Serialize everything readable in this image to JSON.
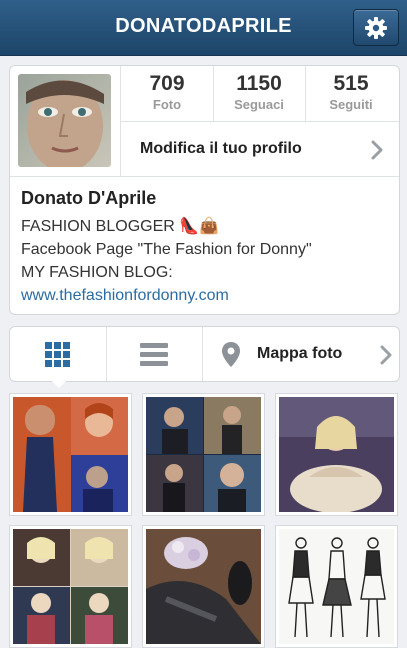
{
  "header": {
    "title": "DONATODAPRILE",
    "settings_icon": "gear-icon"
  },
  "profile": {
    "stats": [
      {
        "value": "709",
        "label": "Foto"
      },
      {
        "value": "1150",
        "label": "Seguaci"
      },
      {
        "value": "515",
        "label": "Seguiti"
      }
    ],
    "edit_label": "Modifica il tuo profilo",
    "name": "Donato D'Aprile",
    "bio_lines": [
      "FASHION BLOGGER 👠👜",
      "Facebook Page \"The Fashion for Donny\"",
      "MY FASHION BLOG:"
    ],
    "website": "www.thefashionfordonny.com"
  },
  "view_tabs": {
    "grid_icon": "grid-icon",
    "list_icon": "list-icon",
    "map_icon": "location-pin-icon",
    "map_label": "Mappa foto"
  },
  "colors": {
    "header": "#1e4569",
    "link": "#2c6ca0",
    "selected_tab": "#2d6ca0"
  }
}
